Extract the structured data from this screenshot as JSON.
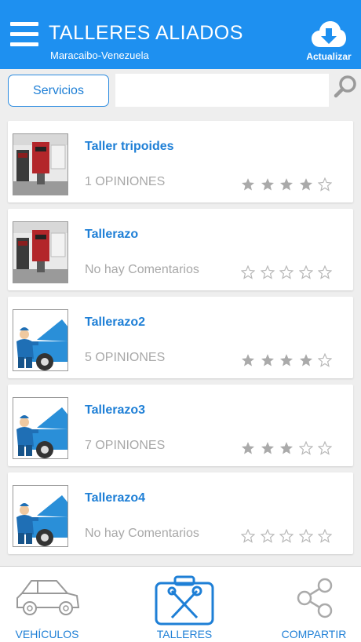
{
  "header": {
    "title": "TALLERES ALIADOS",
    "subtitle": "Maracaibo-Venezuela",
    "refresh_label": "Actualizar",
    "menu_icon": "hamburger-menu-icon",
    "refresh_icon": "cloud-download-icon",
    "background_color": "#1e90f0"
  },
  "search": {
    "services_label": "Servicios",
    "placeholder": "",
    "value": "",
    "search_icon": "search-icon"
  },
  "workshops": [
    {
      "name": "Taller tripoides",
      "opinions": "1 OPINIONES",
      "rating": 4,
      "image": "garage-photo"
    },
    {
      "name": "Tallerazo",
      "opinions": "No hay Comentarios",
      "rating": 0,
      "image": "garage-photo"
    },
    {
      "name": "Tallerazo2",
      "opinions": "5 OPINIONES",
      "rating": 4,
      "image": "mechanic-illustration"
    },
    {
      "name": "Tallerazo3",
      "opinions": "7 OPINIONES",
      "rating": 3,
      "image": "mechanic-illustration"
    },
    {
      "name": "Tallerazo4",
      "opinions": "No hay Comentarios",
      "rating": 0,
      "image": "mechanic-illustration"
    }
  ],
  "rating_max": 5,
  "bottom_nav": {
    "vehicles_label": "VEHÍCULOS",
    "workshops_label": "TALLERES",
    "share_label": "COMPARTIR",
    "active": "TALLERES"
  },
  "colors": {
    "accent": "#1e7fd6",
    "star_filled": "#aaaaaa",
    "star_empty": "#b8b8b8"
  }
}
